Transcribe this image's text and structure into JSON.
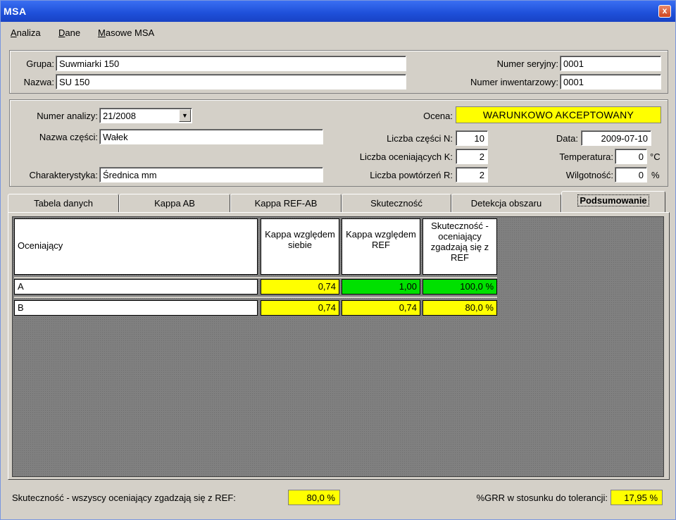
{
  "window": {
    "title": "MSA",
    "close_glyph": "x"
  },
  "menu": [
    "Analiza",
    "Dane",
    "Masowe MSA"
  ],
  "device": {
    "grupa_label": "Grupa:",
    "grupa_value": "Suwmiarki 150",
    "nazwa_label": "Nazwa:",
    "nazwa_value": "SU 150",
    "serial_label": "Numer seryjny:",
    "serial_value": "0001",
    "inventory_label": "Numer inwentarzowy:",
    "inventory_value": "0001"
  },
  "analysis": {
    "numer_label": "Numer analizy:",
    "numer_value": "21/2008",
    "czesc_label": "Nazwa części:",
    "czesc_value": "Wałek",
    "char_label": "Charakterystyka:",
    "char_value": "Średnica mm",
    "ocena_label": "Ocena:",
    "ocena_value": "WARUNKOWO AKCEPTOWANY",
    "parts_label": "Liczba części N:",
    "parts_value": "10",
    "appraisers_label": "Liczba oceniających K:",
    "appraisers_value": "2",
    "repeats_label": "Liczba powtórzeń R:",
    "repeats_value": "2",
    "date_label": "Data:",
    "date_value": "2009-07-10",
    "temp_label": "Temperatura:",
    "temp_value": "0",
    "temp_unit": "°C",
    "humidity_label": "Wilgotność:",
    "humidity_value": "0",
    "humidity_unit": "%"
  },
  "tabs": [
    {
      "label": "Tabela danych"
    },
    {
      "label": "Kappa AB"
    },
    {
      "label": "Kappa REF-AB"
    },
    {
      "label": "Skuteczność"
    },
    {
      "label": "Detekcja obszaru"
    },
    {
      "label": "Podsumowanie",
      "active": true
    }
  ],
  "table": {
    "headers": [
      "Oceniający",
      "Kappa względem siebie",
      "Kappa względem REF",
      "Skuteczność - oceniający zgadzają się z REF"
    ],
    "rows": [
      {
        "name": "A",
        "kappa_self": "0,74",
        "kappa_ref": "1,00",
        "effectiveness": "100,0 %"
      },
      {
        "name": "B",
        "kappa_self": "0,74",
        "kappa_ref": "0,74",
        "effectiveness": "80,0 %"
      }
    ],
    "colors": {
      "yellow": "#ffff00",
      "green": "#00e000"
    }
  },
  "status": {
    "all_label": "Skuteczność - wszyscy oceniający zgadzają się z REF:",
    "all_value": "80,0 %",
    "grr_label": "%GRR w stosunku do tolerancji:",
    "grr_value": "17,95 %"
  }
}
